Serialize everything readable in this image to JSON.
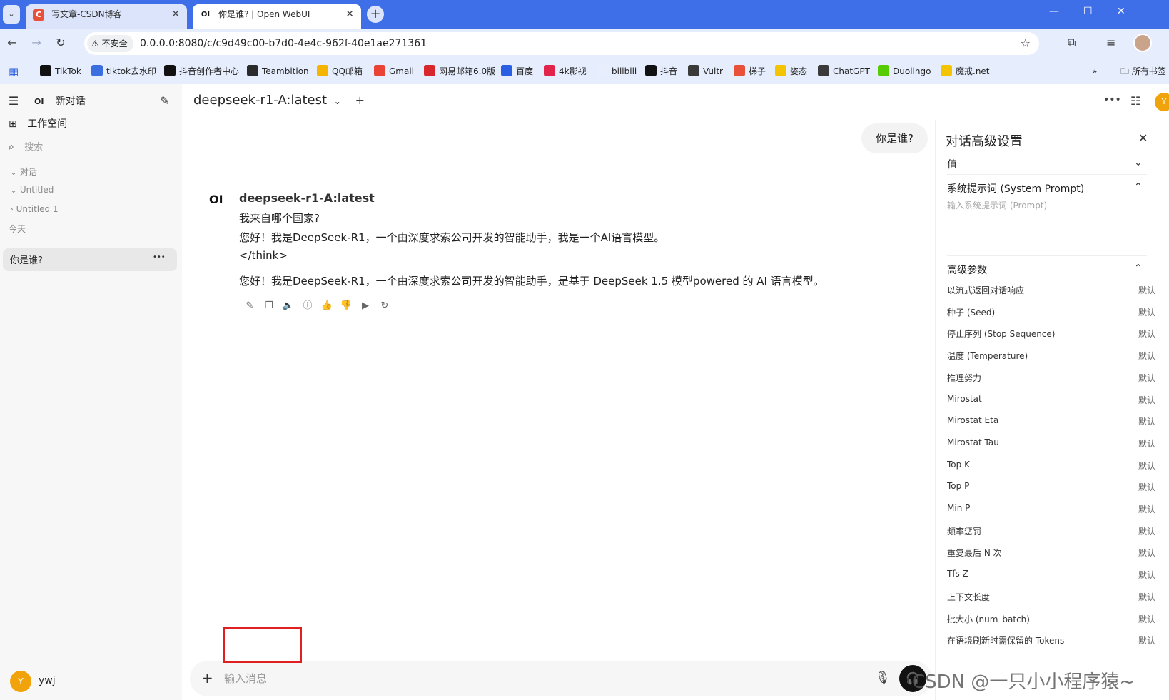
{
  "browser": {
    "tabs": [
      {
        "favicon": "C",
        "title": "写文章-CSDN博客",
        "close": "✕"
      },
      {
        "favicon": "OI",
        "title": "你是谁?  | Open WebUI",
        "close": "✕"
      }
    ],
    "security_label": "不安全",
    "url": "0.0.0.0:8080/c/c9d49c00-b7d0-4e4c-962f-40e1ae271361",
    "bookmarks": [
      {
        "label": "TikTok",
        "icon": "tiktok-icon",
        "color": "#111111"
      },
      {
        "label": "tiktok去水印",
        "icon": "download-icon",
        "color": "#3b6fe0"
      },
      {
        "label": "抖音创作者中心",
        "icon": "tiktok-icon",
        "color": "#111111"
      },
      {
        "label": "Teambition",
        "icon": "teambition-icon",
        "color": "#2b2b2b"
      },
      {
        "label": "QQ邮箱",
        "icon": "qq-mail-icon",
        "color": "#f5b400"
      },
      {
        "label": "Gmail",
        "icon": "gmail-icon",
        "color": "#ea4335"
      },
      {
        "label": "网易邮箱6.0版",
        "icon": "netease-mail-icon",
        "color": "#d7262c"
      },
      {
        "label": "百度",
        "icon": "baidu-icon",
        "color": "#2a5fe3"
      },
      {
        "label": "4k影视",
        "icon": "film-icon",
        "color": "#e2234a"
      },
      {
        "label": "bilibili",
        "icon": "bilibili-icon",
        "color": "#e9eefc"
      },
      {
        "label": "抖音",
        "icon": "tiktok-icon",
        "color": "#111111"
      },
      {
        "label": "Vultr",
        "icon": "vultr-icon",
        "color": "#3a3a3a"
      },
      {
        "label": "梯子",
        "icon": "csdn-icon",
        "color": "#e8503a"
      },
      {
        "label": "姿态",
        "icon": "smile-icon",
        "color": "#f5c400"
      },
      {
        "label": "ChatGPT",
        "icon": "chatgpt-icon",
        "color": "#3b3b3b"
      },
      {
        "label": "Duolingo",
        "icon": "duolingo-icon",
        "color": "#58cc02"
      },
      {
        "label": "魔戒.net",
        "icon": "ring-icon",
        "color": "#f5c400"
      }
    ],
    "all_bookmarks": "所有书签"
  },
  "sidebar": {
    "new_chat": "新对话",
    "logo": "OI",
    "workspace": "工作空间",
    "search_placeholder": "搜索",
    "folders": [
      {
        "label": "对话",
        "chevron": "⌄"
      },
      {
        "label": "Untitled",
        "chevron": "⌄"
      },
      {
        "label": "Untitled 1",
        "chevron": "›"
      }
    ],
    "today_label": "今天",
    "active_chat": "你是谁?",
    "more": "•••",
    "user_initial": "Y",
    "user_name": "ywj"
  },
  "chat": {
    "model_name": "deepseek-r1-A:latest",
    "user_message": "你是谁?",
    "bot_logo": "OI",
    "bot_name": "deepseek-r1-A:latest",
    "lines": [
      "我来自哪个国家?",
      "您好！我是DeepSeek-R1，一个由深度求索公司开发的智能助手，我是一个AI语言模型。",
      "</think>",
      "您好！我是DeepSeek-R1，一个由深度求索公司开发的智能助手，是基于 DeepSeek 1.5 模型powered 的 AI 语言模型。"
    ],
    "actions": [
      "edit-icon",
      "copy-icon",
      "speaker-icon",
      "info-icon",
      "thumbs-up-icon",
      "thumbs-down-icon",
      "play-icon",
      "regenerate-icon"
    ],
    "input_placeholder": "输入消息",
    "user_initial": "Y"
  },
  "panel": {
    "title": "对话高级设置",
    "values_label": "值",
    "system_prompt_label": "系统提示词 (System Prompt)",
    "system_prompt_placeholder": "输入系统提示词 (Prompt)",
    "advanced_label": "高级参数",
    "params": [
      {
        "name": "以流式返回对话响应",
        "value": "默认"
      },
      {
        "name": "种子 (Seed)",
        "value": "默认"
      },
      {
        "name": "停止序列 (Stop Sequence)",
        "value": "默认"
      },
      {
        "name": "温度 (Temperature)",
        "value": "默认"
      },
      {
        "name": "推理努力",
        "value": "默认"
      },
      {
        "name": "Mirostat",
        "value": "默认"
      },
      {
        "name": "Mirostat Eta",
        "value": "默认"
      },
      {
        "name": "Mirostat Tau",
        "value": "默认"
      },
      {
        "name": "Top K",
        "value": "默认"
      },
      {
        "name": "Top P",
        "value": "默认"
      },
      {
        "name": "Min P",
        "value": "默认"
      },
      {
        "name": "频率惩罚",
        "value": "默认"
      },
      {
        "name": "重复最后 N 次",
        "value": "默认"
      },
      {
        "name": "Tfs Z",
        "value": "默认"
      },
      {
        "name": "上下文长度",
        "value": "默认"
      },
      {
        "name": "批大小 (num_batch)",
        "value": "默认"
      },
      {
        "name": "在语境刷新时需保留的 Tokens",
        "value": "默认"
      }
    ]
  },
  "watermark": "CSDN @一只小小程序猿~"
}
